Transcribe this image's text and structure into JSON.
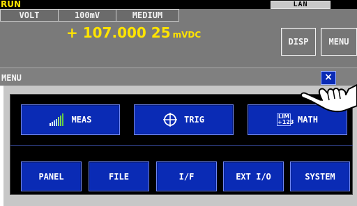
{
  "status": {
    "run": "RUN",
    "lan": "LAN"
  },
  "params": {
    "function": "VOLT",
    "range": "100mV",
    "speed": "MEDIUM"
  },
  "reading": {
    "value": "+ 107.000 25",
    "unit": "mVDC"
  },
  "top_buttons": {
    "disp": "DISP",
    "menu": "MENU"
  },
  "menu": {
    "title": "MENU",
    "close": "×",
    "row1": {
      "meas": "MEAS",
      "trig": "TRIG",
      "math": "MATH",
      "math_icon_top": "LIM",
      "math_icon_bottom": "+123"
    },
    "row2": {
      "panel": "PANEL",
      "file": "FILE",
      "if": "I/F",
      "ext_io": "EXT I/O",
      "system": "SYSTEM"
    }
  },
  "colors": {
    "accent_yellow": "#ffe400",
    "button_blue": "#0a2bb5",
    "panel_gray": "#7a7a7a"
  },
  "icons": [
    "meas-bars-icon",
    "trig-crosshair-icon",
    "lim-math-icon",
    "close-icon",
    "pointing-hand-icon"
  ]
}
